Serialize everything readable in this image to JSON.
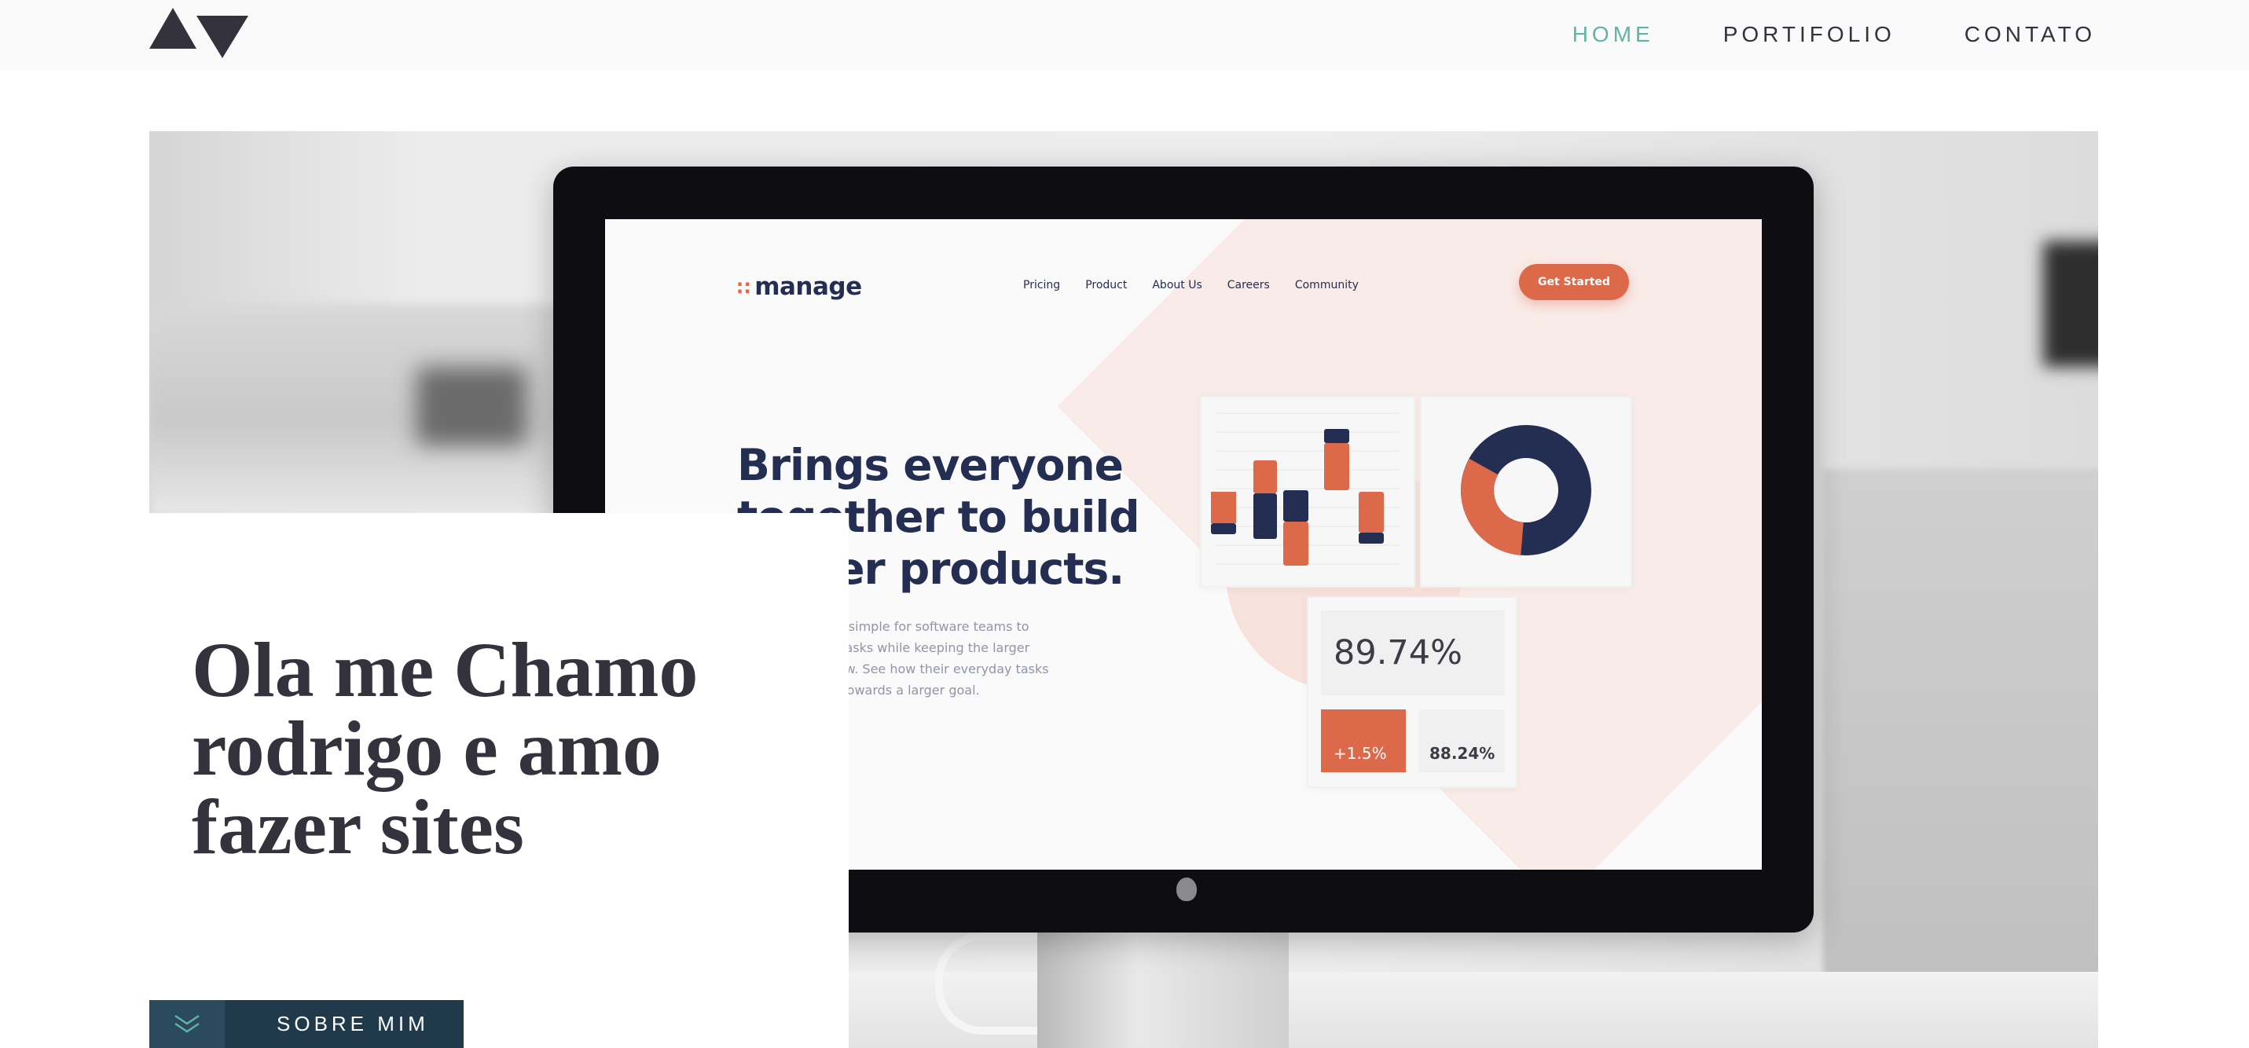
{
  "header": {
    "logo_icon": "av-triangles-logo",
    "nav": [
      {
        "label": "HOME",
        "active": true
      },
      {
        "label": "PORTIFOLIO",
        "active": false
      },
      {
        "label": "CONTATO",
        "active": false
      }
    ],
    "active_color": "#5fb4a2",
    "text_color": "#33323d"
  },
  "hero": {
    "title": "Ola me Chamo rodrigo e amo fazer sites",
    "about_button": {
      "label": "SOBRE MIM",
      "icon": "double-chevron-down-icon"
    }
  },
  "mockup": {
    "brand": "manage",
    "nav": [
      "Pricing",
      "Product",
      "About Us",
      "Careers",
      "Community"
    ],
    "cta": "Get Started",
    "headline": "Brings everyone together to build better products.",
    "subtext": "Manage makes it simple for software teams to plan day-to-day tasks while keeping the larger team goals in view. See how their everyday tasks are contributing towards a larger goal.",
    "stat_main": "89.74%",
    "stat_delta": "+1.5%",
    "stat_secondary": "88.24%",
    "accent": "#dc6a4a",
    "navy": "#242d52"
  }
}
